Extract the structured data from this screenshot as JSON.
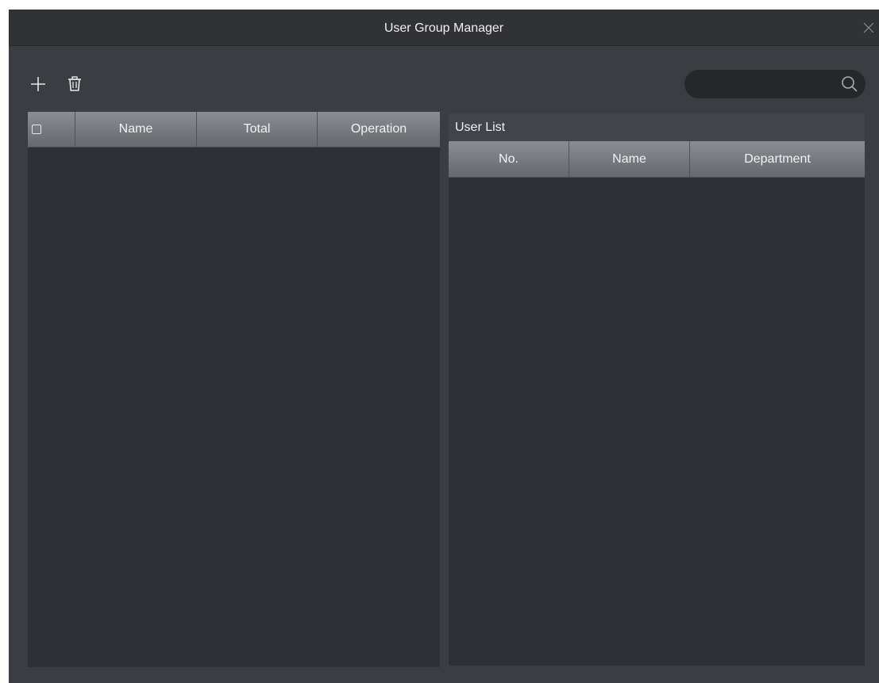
{
  "window": {
    "title": "User Group Manager"
  },
  "toolbar": {
    "add_icon": "plus-icon",
    "delete_icon": "trash-icon"
  },
  "search": {
    "value": "",
    "placeholder": "",
    "icon": "search-icon"
  },
  "group_table": {
    "columns": [
      "Name",
      "Total",
      "Operation"
    ],
    "rows": []
  },
  "user_list": {
    "title": "User List",
    "columns": [
      "No.",
      "Name",
      "Department"
    ],
    "rows": []
  },
  "colors": {
    "window_bg": "#3a3d42",
    "titlebar_bg": "#303236",
    "panel_bg": "#2d3035",
    "header_top": "#8a8d93",
    "header_bottom": "#65686d"
  }
}
